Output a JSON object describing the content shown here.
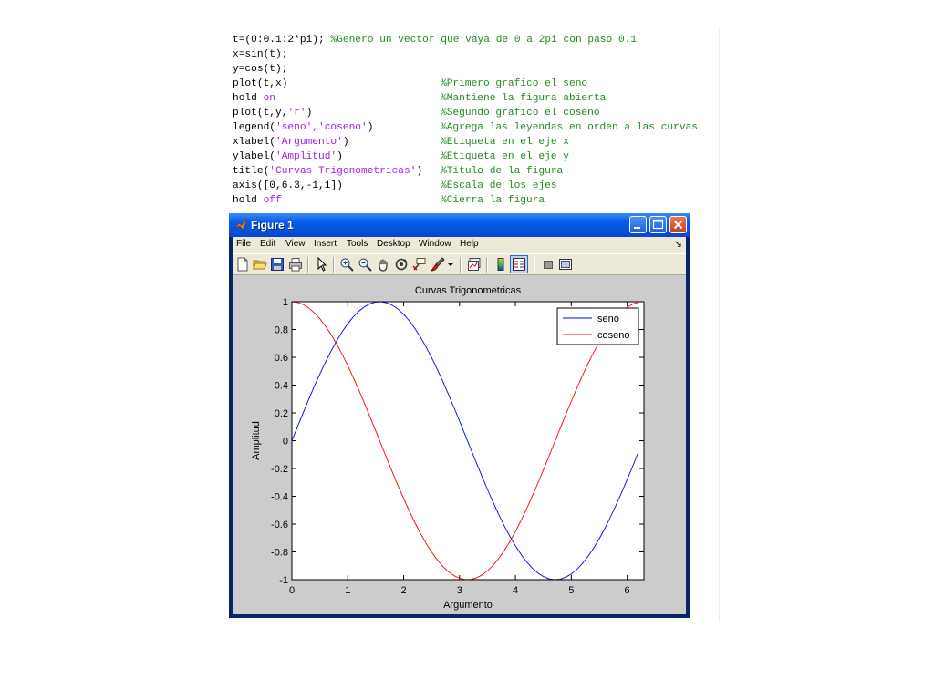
{
  "code": [
    {
      "code": "t=(0:0.1:2*pi);",
      "comment": "%Genero un vector que vaya de 0 a 2pi con paso 0.1"
    },
    {
      "code": "x=sin(t);",
      "comment": ""
    },
    {
      "code": "y=cos(t);",
      "comment": ""
    },
    {
      "code": "plot(t,x)",
      "comment": "%Primero grafico el seno"
    },
    {
      "code_pre": "hold ",
      "code_kw": "on",
      "comment": "%Mantiene la figura abierta"
    },
    {
      "code_pre": "plot(t,y,",
      "code_str": "'r'",
      "code_post": ")",
      "comment": "%Segundo grafico el coseno"
    },
    {
      "code_pre": "legend(",
      "code_str": "'seno','coseno'",
      "code_post": ")",
      "comment": "%Agrega las leyendas en orden a las curvas"
    },
    {
      "code_pre": "xlabel(",
      "code_str": "'Argumento'",
      "code_post": ")",
      "comment": "%Etiqueta en el eje x"
    },
    {
      "code_pre": "ylabel(",
      "code_str": "'Amplitud'",
      "code_post": ")",
      "comment": "%Etiqueta en el eje y"
    },
    {
      "code_pre": "title(",
      "code_str": "'Curvas Trigonometricas'",
      "code_post": ")",
      "comment": "%Titulo de la figura"
    },
    {
      "code": "axis([0,6.3,-1,1])",
      "comment": "%Escala de los ejes"
    },
    {
      "code_pre": "hold ",
      "code_kw": "off",
      "comment": "%Cierra la figura"
    }
  ],
  "window": {
    "title": "Figure 1",
    "menu": [
      "File",
      "Edit",
      "View",
      "Insert",
      "Tools",
      "Desktop",
      "Window",
      "Help"
    ],
    "dock_glyph": "↘",
    "colors": {
      "titlebar": "#0a5ce8",
      "chrome": "#ece9d8",
      "canvas": "#cccccc"
    }
  },
  "toolbar": {
    "icons": [
      "new-file-icon",
      "open-folder-icon",
      "save-icon",
      "print-icon",
      "edit-plot-arrow-icon",
      "zoom-in-icon",
      "zoom-out-icon",
      "pan-hand-icon",
      "rotate-3d-icon",
      "data-cursor-icon",
      "brush-icon",
      "brush-dropdown-icon",
      "link-plot-icon",
      "colorbar-icon",
      "legend-icon",
      "hide-plot-tools-icon",
      "show-plot-tools-icon"
    ]
  },
  "chart_data": {
    "type": "line",
    "title": "Curvas Trigonometricas",
    "xlabel": "Argumento",
    "ylabel": "Amplitud",
    "xlim": [
      0,
      6.3
    ],
    "ylim": [
      -1,
      1
    ],
    "xticks": [
      0,
      1,
      2,
      3,
      4,
      5,
      6
    ],
    "yticks": [
      -1,
      -0.8,
      -0.6,
      -0.4,
      -0.2,
      0,
      0.2,
      0.4,
      0.6,
      0.8,
      1
    ],
    "x": {
      "start": 0,
      "step": 0.1,
      "end": 6.2
    },
    "series": [
      {
        "name": "seno",
        "function": "sin",
        "color": "#0000ff"
      },
      {
        "name": "coseno",
        "function": "cos",
        "color": "#ff0000"
      }
    ],
    "legend": {
      "position": "top-right",
      "entries": [
        "seno",
        "coseno"
      ]
    }
  }
}
